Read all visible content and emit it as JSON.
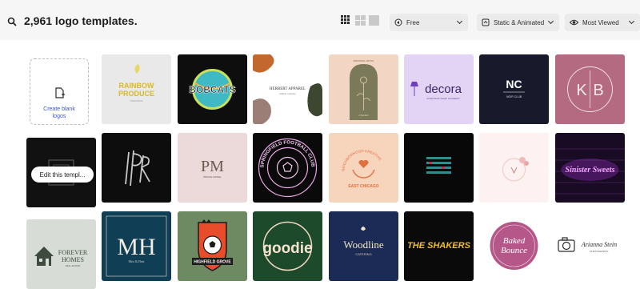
{
  "toolbar": {
    "result_count": "2,961 logo templates.",
    "license_filter": "Free",
    "type_filter": "Static & Animated",
    "sort_filter": "Most Viewed"
  },
  "blank_card": {
    "label_line1": "Create blank",
    "label_line2": "logos"
  },
  "hover_card": {
    "edit_label": "Edit this templ..."
  },
  "logos": {
    "rainbow": {
      "line1": "RAINBOW",
      "line2": "PRODUCE",
      "line3": "ORGANICS"
    },
    "bobcats": {
      "name": "BOBCATS"
    },
    "herbert": {
      "name": "HERBERT APPAREL",
      "tag": "fashion company"
    },
    "ariel": {
      "top": "WEDDING ARTIST",
      "bottom": "ATELIER"
    },
    "decora": {
      "name": "decora",
      "tag": "virtual interior design consultation"
    },
    "nc": {
      "initials": "NC",
      "tag": "NOIR CLUB"
    },
    "kb": {
      "k": "K",
      "b": "B"
    },
    "pm": {
      "initials": "PM",
      "tag": "PRINCE MODEL"
    },
    "springfield": {
      "ring": "SPRINGFIELD FOOTBALL CLUB"
    },
    "eastchicago": {
      "ring": "NEIGHBORHOOD CREATIVE",
      "name": "EAST CHICAGO"
    },
    "sinister": {
      "name": "Sinister Sweets"
    },
    "forever": {
      "line1": "FOREVER",
      "line2": "HOMES",
      "tag": "REAL ESTATE"
    },
    "mh": {
      "initials": "MH",
      "tag": "Mist & Heat"
    },
    "highfield": {
      "name": "HIGHFIELD GROVE"
    },
    "goodie": {
      "name": "goodie"
    },
    "woodline": {
      "name": "Woodline",
      "tag": "CATERING"
    },
    "shakers": {
      "name": "THE SHAKERS"
    },
    "baked": {
      "line1": "Baked",
      "line2": "Bounce"
    },
    "arianna": {
      "name": "Arianna Stein",
      "tag": "PHOTOGRAPHY"
    }
  },
  "colors": {
    "accent": "#3a54d9",
    "toolbar_bg": "#f6f6f6",
    "dropdown_bg": "#ebebeb"
  }
}
